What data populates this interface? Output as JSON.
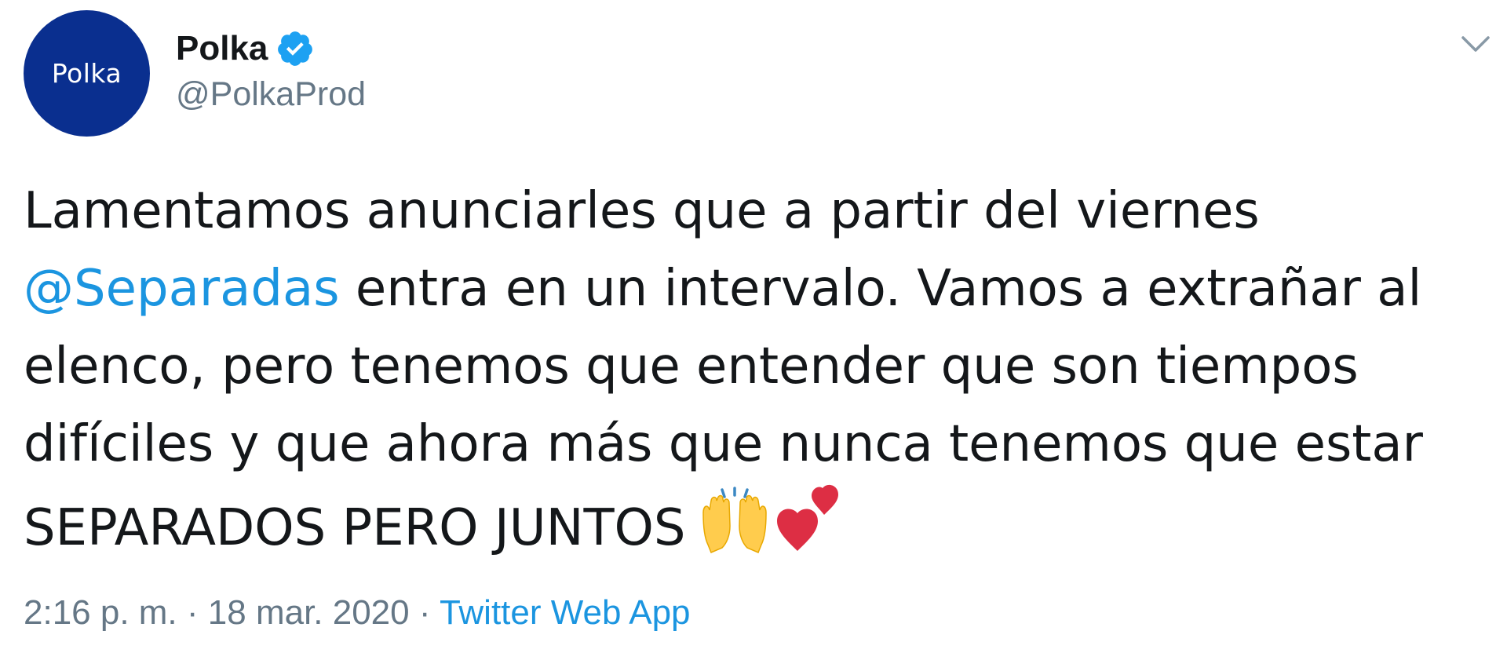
{
  "account": {
    "avatar_text": "Polka",
    "display_name": "Polka",
    "handle": "@PolkaProd",
    "verified": true
  },
  "tweet": {
    "line1": "Lamentamos anunciarles que a partir del viernes",
    "mention": "@Separadas",
    "line2_rest": " entra en un intervalo. Vamos a extrañar al",
    "line3": "elenco, pero tenemos que entender que son tiempos",
    "line4": "difíciles y que ahora más que nunca tenemos que estar",
    "line5": "SEPARADOS PERO JUNTOS",
    "emojis": [
      "raising-hands-emoji",
      "two-hearts-emoji"
    ]
  },
  "meta": {
    "time": "2:16 p. m.",
    "separator1": " · ",
    "date": "18 mar. 2020",
    "separator2": " · ",
    "source": "Twitter Web App"
  },
  "colors": {
    "avatar_bg": "#0a2f8f",
    "link": "#1b95e0",
    "text": "#14171a",
    "secondary": "#657786"
  }
}
